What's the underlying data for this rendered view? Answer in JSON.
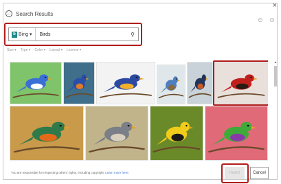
{
  "dialog": {
    "close_glyph": "×",
    "back_glyph": "←",
    "title": "Search Results",
    "faces": "☺ ☺"
  },
  "search": {
    "provider_label": "Bing",
    "provider_caret": "▾",
    "provider_logo": "b",
    "query": "Birds",
    "search_glyph": "⚲"
  },
  "filters": [
    {
      "label": "Size ▾"
    },
    {
      "label": "Type ▾"
    },
    {
      "label": "Color ▾"
    },
    {
      "label": "Layout ▾"
    },
    {
      "label": "License ▾"
    }
  ],
  "images": [
    {
      "name": "blue-birds-flying-image",
      "bg": "#7fc46b",
      "bird": "#3a6fd8",
      "accent": "#ffffff"
    },
    {
      "name": "blue-orange-bird-image",
      "bg": "#3f6f8a",
      "bird": "#2a4fa8",
      "accent": "#e07b2a"
    },
    {
      "name": "blue-bird-branch-image",
      "bg": "#f3f3f3",
      "bird": "#2b4aa0",
      "accent": "#f2b02a"
    },
    {
      "name": "small-blue-bird-image",
      "bg": "#dfe7ea",
      "bird": "#4f7fbf",
      "accent": "#8a6a3a"
    },
    {
      "name": "swallow-bird-image",
      "bg": "#c8d2d8",
      "bird": "#22345a",
      "accent": "#c85a2a"
    },
    {
      "name": "red-cardinal-image",
      "bg": "#e9e0dc",
      "bird": "#c0201c",
      "accent": "#2a1a14"
    },
    {
      "name": "hummingbird-image",
      "bg": "#c89a4a",
      "bird": "#2f7a4a",
      "accent": "#e46a1a"
    },
    {
      "name": "gray-bird-image",
      "bg": "#c2b48a",
      "bird": "#7a7f88",
      "accent": "#d8d0bc"
    },
    {
      "name": "goldfinch-image",
      "bg": "#6a8a2a",
      "bird": "#f2cc1a",
      "accent": "#1a1a1a"
    },
    {
      "name": "gouldian-finch-image",
      "bg": "#e06a78",
      "bird": "#3faa3a",
      "accent": "#8a3aa8"
    }
  ],
  "footer": {
    "notice": "You are responsible for respecting others' rights, including copyright.",
    "link": "Learn more here."
  },
  "buttons": {
    "insert": "Insert",
    "cancel": "Cancel"
  },
  "scroll_up_glyph": "▲"
}
